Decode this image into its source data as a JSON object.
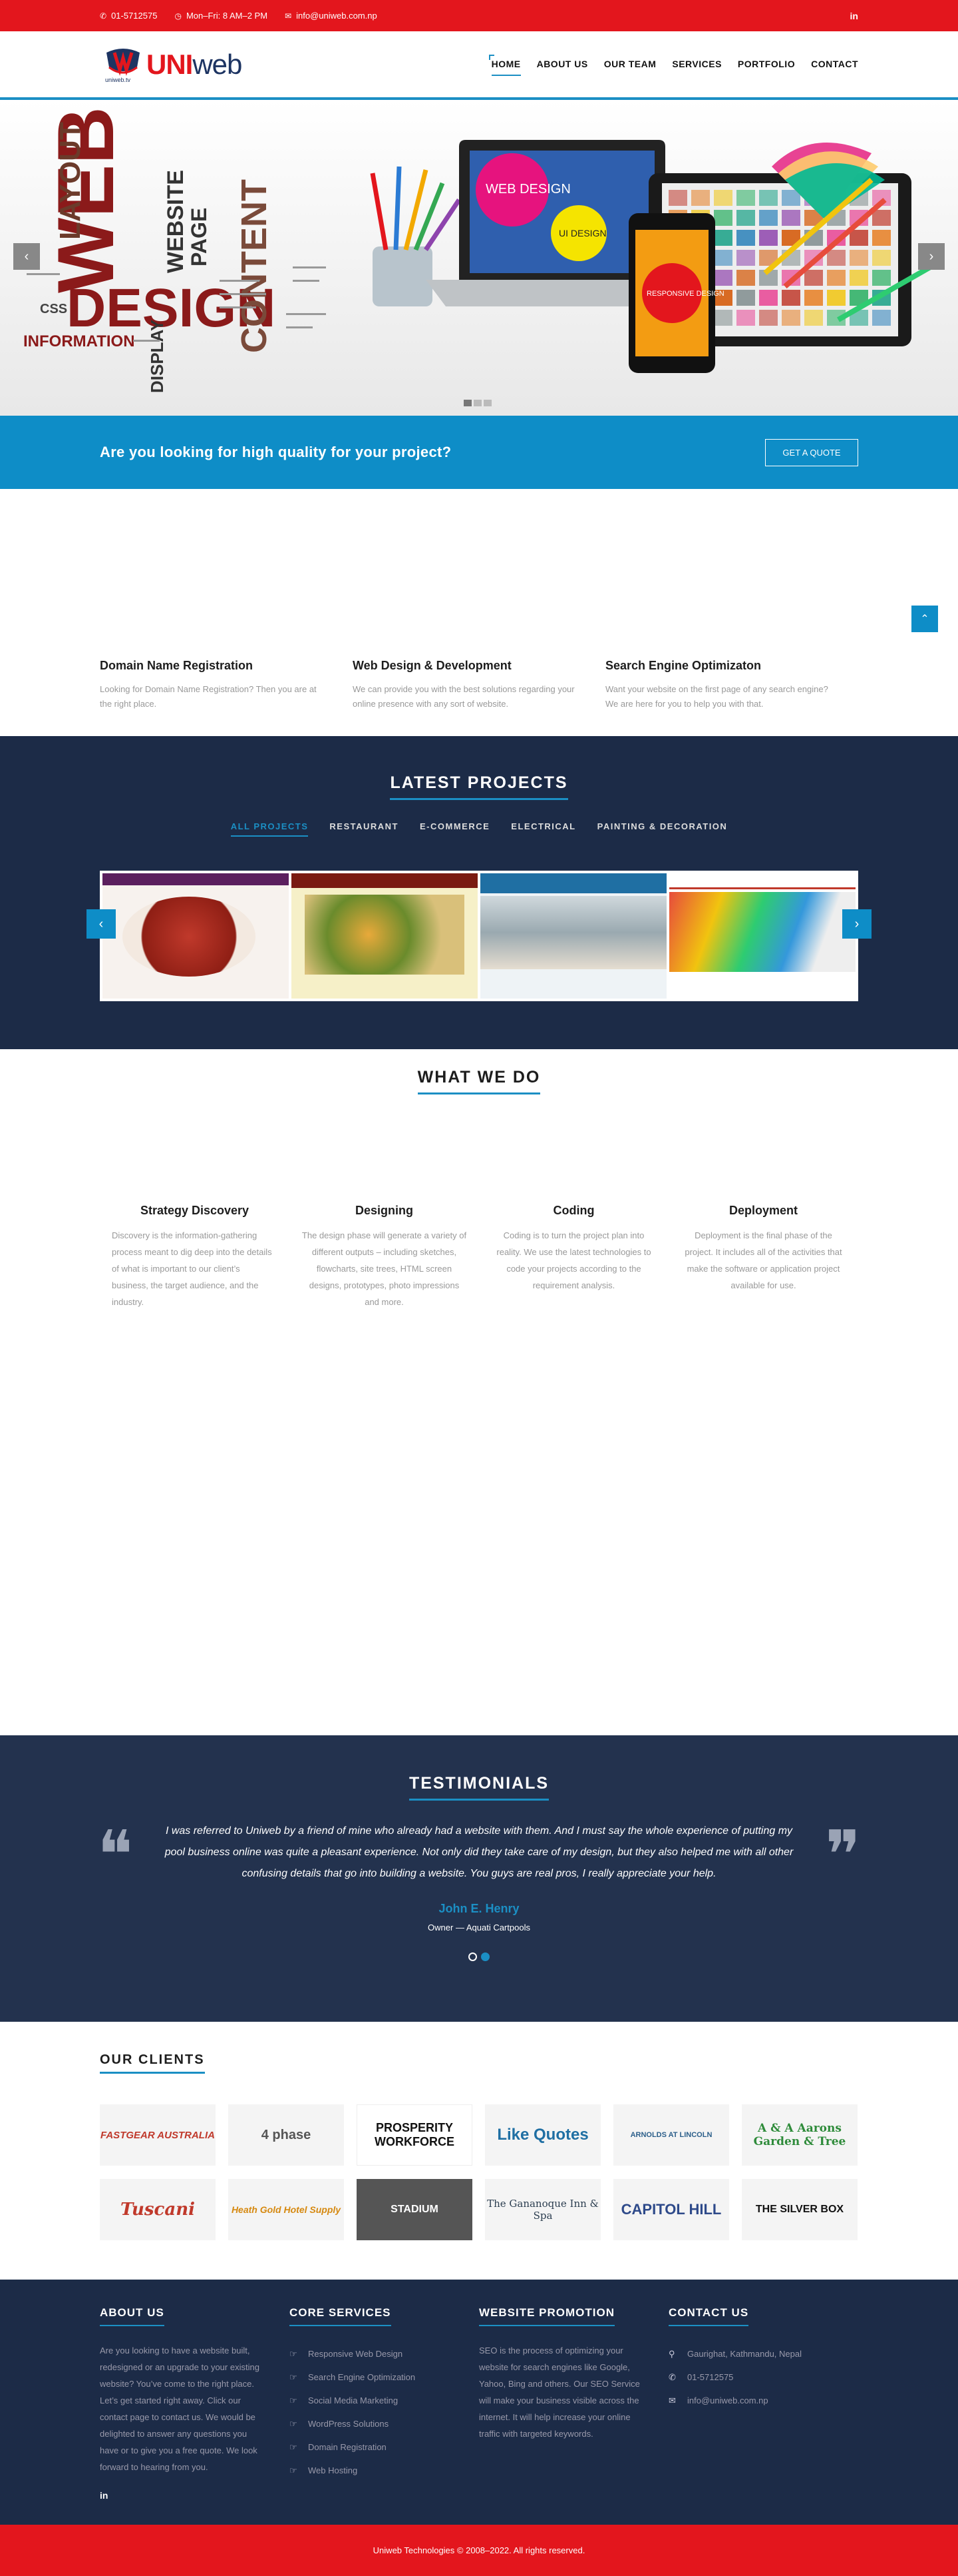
{
  "topbar": {
    "phone": "01-5712575",
    "hours": "Mon–Fri: 8 AM–2 PM",
    "email": "info@uniweb.com.np",
    "social": "in"
  },
  "brand": {
    "logo_u": "UNI",
    "logo_w": "web",
    "logo_small": "uniweb.tv"
  },
  "nav": [
    "HOME",
    "ABOUT US",
    "OUR TEAM",
    "SERVICES",
    "PORTFOLIO",
    "CONTACT"
  ],
  "slider": {
    "prev": "‹",
    "next": "›",
    "words": [
      "WEB",
      "DESIGN",
      "LAYOUT",
      "CONTENT",
      "WEBSITE",
      "PAGE",
      "INFORMATION",
      "DISPLAY",
      "CSS"
    ],
    "screen_labels": [
      "WEB DESIGN",
      "UI DESIGN",
      "RESPONSIVE DESIGN"
    ]
  },
  "quote": {
    "heading": "Are you looking for high quality for your project?",
    "button": "GET A QUOTE"
  },
  "services": [
    {
      "title": "Domain Name Registration",
      "text": "Looking for Domain Name Registration? Then you are at the right place."
    },
    {
      "title": "Web Design & Development",
      "text": "We can provide you with the best solutions regarding your online presence with any sort of website."
    },
    {
      "title": "Search Engine Optimizaton",
      "text": "Want your website on the first page of any search engine? We are here for you to help you with that."
    }
  ],
  "projects": {
    "title": "LATEST PROJECTS",
    "filters": [
      "ALL PROJECTS",
      "RESTAURANT",
      "E-COMMERCE",
      "ELECTRICAL",
      "PAINTING & DECORATION"
    ],
    "prev": "‹",
    "next": "›"
  },
  "what": {
    "title": "WHAT WE DO",
    "steps": [
      {
        "title": "Strategy Discovery",
        "text": "Discovery is the information-gathering process meant to dig deep into the details of what is important to our client’s business, the target audience, and the industry."
      },
      {
        "title": "Designing",
        "text": "The design phase will generate a variety of different outputs – including sketches, flowcharts, site trees, HTML screen designs, prototypes, photo impressions and more."
      },
      {
        "title": "Coding",
        "text": "Coding is to turn the project plan into reality. We use the latest technologies to code your projects according to the requirement analysis."
      },
      {
        "title": "Deployment",
        "text": "Deployment is the final phase of the project. It includes all of the activities that make the software or application project available for use."
      }
    ]
  },
  "testimonials": {
    "title": "TESTIMONIALS",
    "quote": "I was referred to Uniweb by a friend of mine who already had a website with them. And I must say the whole experience of putting my pool business online was quite a pleasant experience. Not only did they take care of my design, but they also helped me with all other confusing details that go into building a website. You guys are real pros, I really appreciate your help.",
    "name": "John E. Henry",
    "role": "Owner — Aquati Cartpools"
  },
  "clients": {
    "title": "OUR CLIENTS",
    "items": [
      "FASTGEAR AUSTRALIA",
      "4 phase",
      "PROSPERITY WORKFORCE",
      "Like Quotes",
      "ARNOLDS AT LINCOLN",
      "A & A Aarons Garden & Tree",
      "Tuscani",
      "Heath Gold Hotel Supply",
      "STADIUM",
      "The Gananoque Inn & Spa",
      "CAPITOL HILL",
      "THE SILVER BOX"
    ]
  },
  "footer": {
    "about_title": "ABOUT US",
    "about_text": "Are you looking to have a website built, redesigned or an upgrade to your existing website? You’ve come to the right place. Let’s get started right away. Click our contact page to contact us. We would be delighted to answer any questions you have or to give you a free quote. We look forward to hearing from you.",
    "social": "in",
    "core_title": "CORE SERVICES",
    "core_items": [
      "Responsive Web Design",
      "Search Engine Optimization",
      "Social Media Marketing",
      "WordPress Solutions",
      "Domain Registration",
      "Web Hosting"
    ],
    "promo_title": "WEBSITE PROMOTION",
    "promo_text": "SEO is the process of optimizing your website for search engines like Google, Yahoo, Bing and others. Our SEO Service will make your business visible across the internet. It will help increase your online traffic with targeted keywords.",
    "contact_title": "CONTACT US",
    "address": "Gaurighat, Kathmandu, Nepal",
    "phone": "01-5712575",
    "email": "info@uniweb.com.np"
  },
  "copyright": "Uniweb Technologies © 2008–2022. All rights reserved.",
  "colors": {
    "red": "#e3161d",
    "blue": "#0e8dc7",
    "navy": "#1c2b47"
  }
}
